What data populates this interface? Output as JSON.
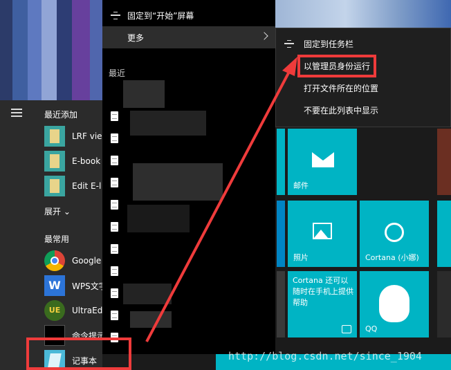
{
  "context_menu_primary": {
    "pin_start": "固定到“开始”屏幕",
    "more": "更多",
    "recent_header": "最近"
  },
  "context_menu_more": {
    "pin_taskbar": "固定到任务栏",
    "run_as_admin": "以管理员身份运行",
    "open_location": "打开文件所在的位置",
    "dont_show": "不要在此列表中显示"
  },
  "start_menu": {
    "recently_added": "最近添加",
    "expand": "展开",
    "most_used": "最常用",
    "recent_apps": [
      "LRF vie",
      "E-book",
      "Edit E-l"
    ],
    "frequent_apps": [
      "Google",
      "WPS文字",
      "UltraEd",
      "命令提示",
      "记事本"
    ]
  },
  "tiles": {
    "mail": "邮件",
    "photos": "照片",
    "cortana": "Cortana (小娜)",
    "cortana_info": "Cortana 还可以随时在手机上提供帮助",
    "qq": "QQ"
  },
  "watermark": "http://blog.csdn.net/since_1904",
  "colors": {
    "tile": "#00b4c4",
    "annotation": "#ef3b3b",
    "menu_bg": "#000000"
  }
}
